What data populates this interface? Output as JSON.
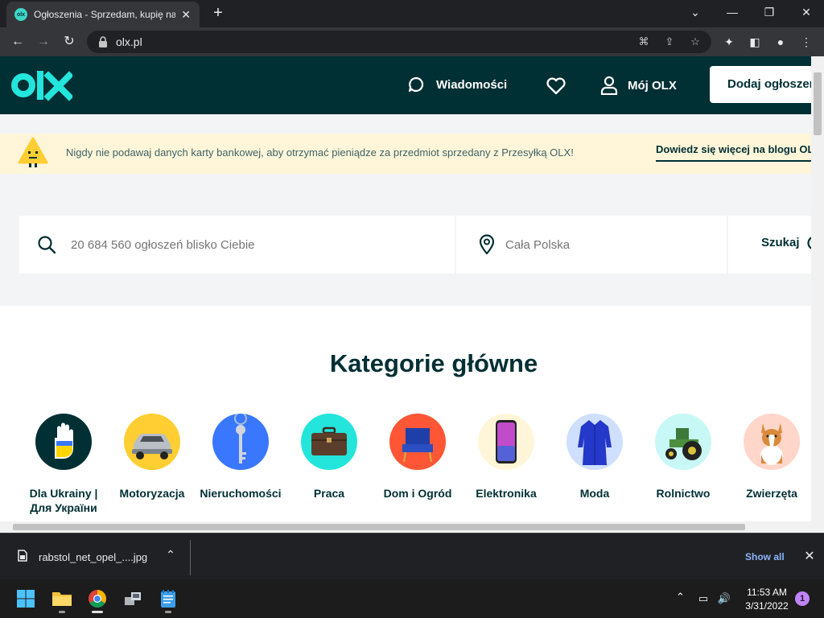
{
  "browser": {
    "tab_title": "Ogłoszenia - Sprzedam, kupię na",
    "tab_favicon": "olx",
    "url": "olx.pl",
    "icons": [
      "back-icon",
      "forward-icon",
      "reload-icon",
      "lock-icon",
      "translate-icon",
      "share-icon",
      "star-icon",
      "extensions-icon",
      "sidepanel-icon",
      "profile-icon",
      "menu-icon"
    ]
  },
  "header": {
    "messages_label": "Wiadomości",
    "my_olx_label": "Mój OLX",
    "add_ad_label": "Dodaj ogłoszenie",
    "colors": {
      "background": "#002f34",
      "logo": "#23e5db"
    }
  },
  "banner": {
    "text": "Nigdy nie podawaj danych karty bankowej, aby otrzymać pieniądze za przedmiot sprzedany z Przesyłką OLX!",
    "link": "Dowiedz się więcej na blogu OLX",
    "background": "#fff6d9"
  },
  "search": {
    "placeholder": "20 684 560 ogłoszeń blisko Ciebie",
    "location_placeholder": "Cała Polska",
    "button_label": "Szukaj"
  },
  "categories": {
    "title": "Kategorie główne",
    "items": [
      {
        "label": "Dla Ukrainy | Для України",
        "color": "#002f34",
        "icon": "hand-ukraine-icon"
      },
      {
        "label": "Motoryzacja",
        "color": "#ffce32",
        "icon": "car-icon"
      },
      {
        "label": "Nieruchomości",
        "color": "#3a77ff",
        "icon": "key-icon"
      },
      {
        "label": "Praca",
        "color": "#23e5db",
        "icon": "briefcase-icon"
      },
      {
        "label": "Dom i Ogród",
        "color": "#ff5636",
        "icon": "armchair-icon"
      },
      {
        "label": "Elektronika",
        "color": "#fff6d9",
        "icon": "phone-icon"
      },
      {
        "label": "Moda",
        "color": "#cfdfff",
        "icon": "dress-icon"
      },
      {
        "label": "Rolnictwo",
        "color": "#c8f8f6",
        "icon": "tractor-icon"
      },
      {
        "label": "Zwierzęta",
        "color": "#ffd6c9",
        "icon": "dog-icon"
      }
    ]
  },
  "downloads": {
    "filename": "rabstol_net_opel_....jpg",
    "show_all": "Show all"
  },
  "taskbar": {
    "time": "11:53 AM",
    "date": "3/31/2022",
    "notification_count": "1"
  }
}
